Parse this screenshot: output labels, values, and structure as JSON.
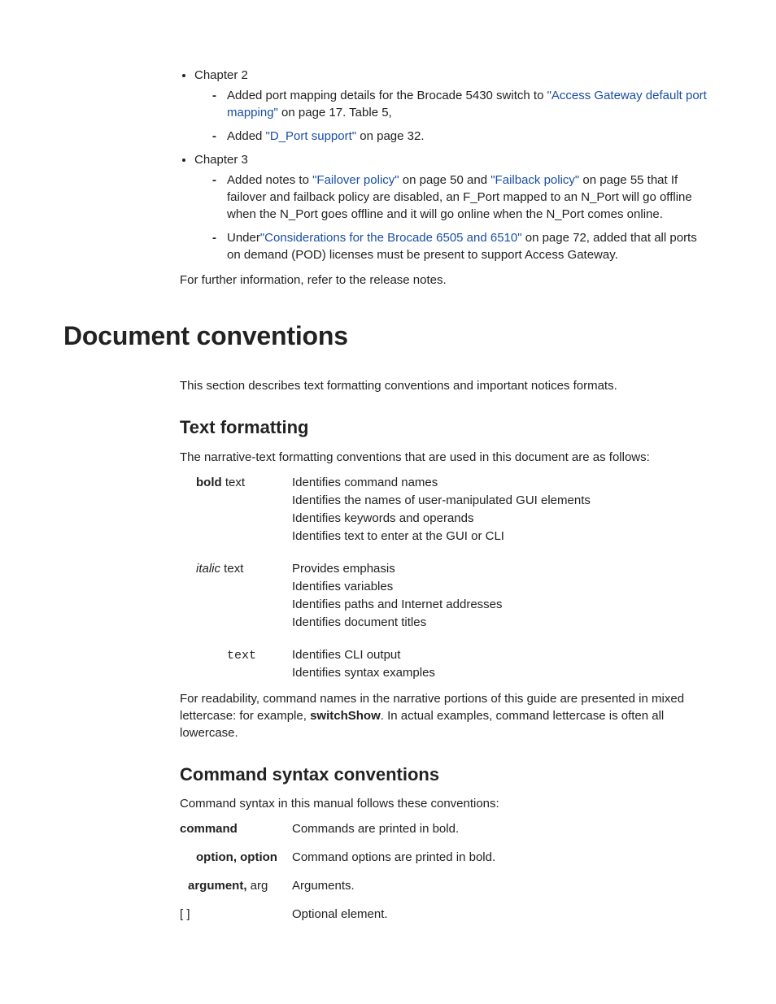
{
  "changes": {
    "chapter2": {
      "title": "Chapter 2",
      "items": [
        {
          "pre": "Added port mapping details for the Brocade 5430 switch to ",
          "link": "\"Access Gateway default port mapping\"",
          "post": " on page 17. Table 5,"
        },
        {
          "pre": "Added ",
          "link": "\"D_Port support\"",
          "post": " on page 32."
        }
      ]
    },
    "chapter3": {
      "title": "Chapter 3",
      "items": [
        {
          "pre": "Added notes to ",
          "link1": "\"Failover policy\"",
          "mid1": " on page 50 and ",
          "link2": "\"Failback policy\"",
          "post": " on page 55 that If failover and failback policy are disabled, an F_Port mapped to an N_Port will go offline when the N_Port goes offline and it will go online when the N_Port comes online."
        },
        {
          "pre": "Under",
          "link": "\"Considerations for the Brocade 6505 and 6510\"",
          "post": " on page 72, added that all ports on demand (POD) licenses must be present to support Access Gateway."
        }
      ]
    },
    "further": "For further information, refer to the release notes."
  },
  "doc_conv": {
    "heading": "Document conventions",
    "intro": "This section describes text formatting conventions and important notices formats."
  },
  "textfmt": {
    "heading": "Text formatting",
    "intro": "The narrative-text formatting conventions that are used in this document are as follows:",
    "rows": [
      {
        "label_bold": "bold",
        "label_rest": " text",
        "lines": [
          "Identifies command names",
          "Identifies the names of user-manipulated GUI elements",
          "Identifies keywords and operands",
          "Identifies text to enter at the GUI or CLI"
        ]
      },
      {
        "label_italic": "italic",
        "label_rest": " text",
        "lines": [
          "Provides emphasis",
          "Identifies variables",
          "Identifies paths and Internet addresses",
          "Identifies document titles"
        ]
      },
      {
        "label_mono": "text",
        "lines": [
          "Identifies CLI output",
          "Identifies syntax examples"
        ]
      }
    ],
    "outro_pre": "For readability, command names in the narrative portions of this guide are presented in mixed lettercase: for example, ",
    "outro_bold": "switchShow",
    "outro_post": ". In actual examples, command lettercase is often all lowercase."
  },
  "cmdsyn": {
    "heading": "Command syntax conventions",
    "intro": "Command syntax in this manual follows these conventions:",
    "rows": [
      {
        "l1": "command",
        "desc": "Commands are printed in bold."
      },
      {
        "l1": "option, option",
        "indent": true,
        "desc": "Command options are printed in bold."
      },
      {
        "l1": "argument,",
        "l2": " arg",
        "indent_half": true,
        "desc": "Arguments."
      },
      {
        "l1": "[ ]",
        "plain": true,
        "desc": "Optional element."
      }
    ]
  }
}
